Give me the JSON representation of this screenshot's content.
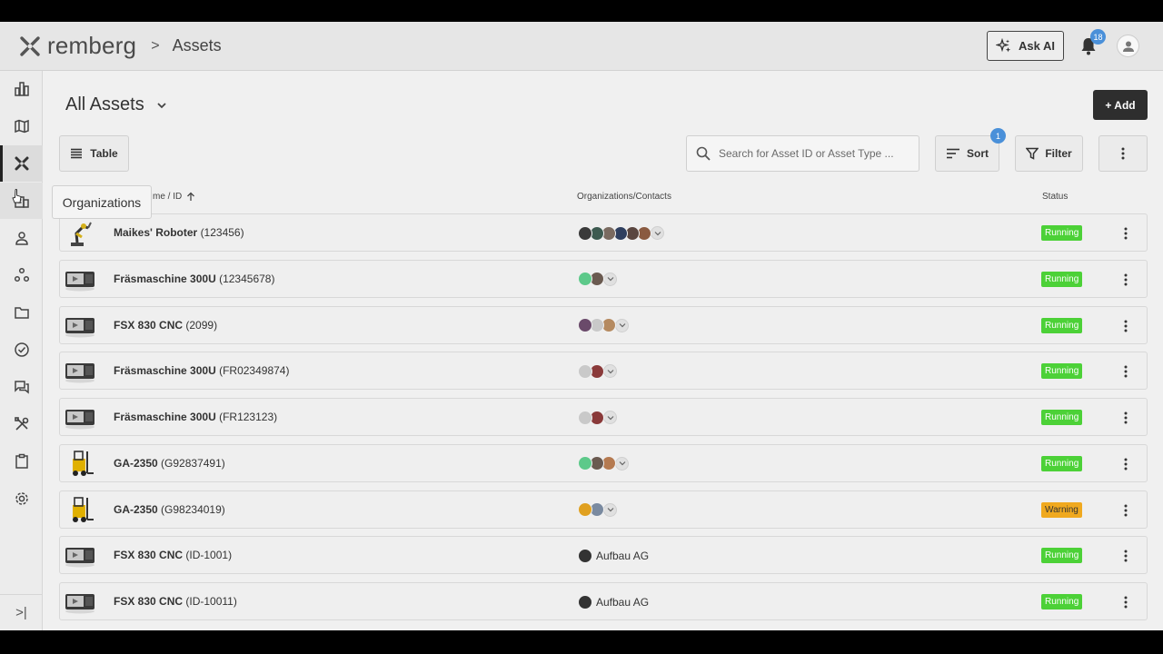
{
  "header": {
    "logo_text": "remberg",
    "breadcrumb_sep": ">",
    "breadcrumb": "Assets",
    "ask_ai_label": "Ask AI",
    "notification_count": "18"
  },
  "sidebar": {
    "items": [
      {
        "icon": "dashboard-chart-icon"
      },
      {
        "icon": "map-icon"
      },
      {
        "icon": "assets-icon"
      },
      {
        "icon": "organizations-icon"
      },
      {
        "icon": "contacts-icon"
      },
      {
        "icon": "workflows-icon"
      },
      {
        "icon": "folder-icon"
      },
      {
        "icon": "tasks-check-icon"
      },
      {
        "icon": "tickets-chat-icon"
      },
      {
        "icon": "work-orders-tools-icon"
      },
      {
        "icon": "forms-clipboard-icon"
      },
      {
        "icon": "settings-gear-icon"
      }
    ],
    "expand_label": ">|",
    "tooltip": "Organizations"
  },
  "main": {
    "title": "All Assets",
    "add_label": "+ Add",
    "view_label": "Table",
    "search_placeholder": "Search for Asset ID or Asset Type ...",
    "sort_label": "Sort",
    "sort_count": "1",
    "filter_label": "Filter",
    "columns": {
      "name": "me / ID",
      "orgs": "Organizations/Contacts",
      "status": "Status"
    }
  },
  "rows": [
    {
      "name": "Maikes' Roboter",
      "id": "(123456)",
      "thumb": "robot-arm",
      "avatars": [
        "#3a3a3a",
        "#3d5a50",
        "#7a6a60",
        "#2f3f5f",
        "#5a4640",
        "#8a5a40"
      ],
      "org_name": "",
      "status": "Running"
    },
    {
      "name": "Fräsmaschine 300U",
      "id": "(12345678)",
      "thumb": "cnc",
      "avatars": [
        "#5dc98a",
        "#6a5a50"
      ],
      "org_name": "",
      "status": "Running"
    },
    {
      "name": "FSX 830 CNC",
      "id": "(2099)",
      "thumb": "cnc",
      "avatars": [
        "#6a4a6a",
        "#c9c9c9",
        "#b58a60"
      ],
      "org_name": "",
      "status": "Running"
    },
    {
      "name": "Fräsmaschine 300U",
      "id": "(FR02349874)",
      "thumb": "cnc",
      "avatars": [
        "#c9c9c9",
        "#8a3a3a"
      ],
      "org_name": "",
      "status": "Running"
    },
    {
      "name": "Fräsmaschine 300U",
      "id": "(FR123123)",
      "thumb": "cnc",
      "avatars": [
        "#c9c9c9",
        "#8a3a3a"
      ],
      "org_name": "",
      "status": "Running"
    },
    {
      "name": "GA-2350",
      "id": "(G92837491)",
      "thumb": "forklift",
      "avatars": [
        "#5dc98a",
        "#6a5a50",
        "#b57a50"
      ],
      "org_name": "",
      "status": "Running"
    },
    {
      "name": "GA-2350",
      "id": "(G98234019)",
      "thumb": "forklift",
      "avatars": [
        "#e0a020",
        "#7a8aa0"
      ],
      "org_name": "",
      "status": "Warning"
    },
    {
      "name": "FSX 830 CNC",
      "id": "(ID-1001)",
      "thumb": "cnc",
      "avatars": [
        "#333333"
      ],
      "org_name": "Aufbau AG",
      "status": "Running"
    },
    {
      "name": "FSX 830 CNC",
      "id": "(ID-10011)",
      "thumb": "cnc",
      "avatars": [
        "#333333"
      ],
      "org_name": "Aufbau AG",
      "status": "Running"
    }
  ]
}
